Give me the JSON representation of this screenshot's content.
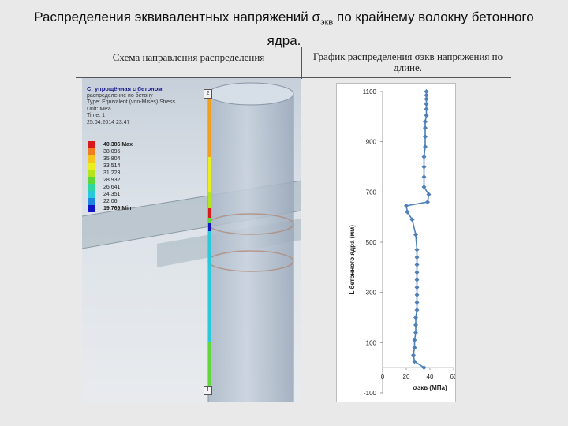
{
  "slide": {
    "title_part1": "Распределения эквивалентных напряжений σ",
    "title_sub": "экв",
    "title_part2": " по крайнему волокну бетонного ядра."
  },
  "table": {
    "left_header": "Схема направления распределения",
    "right_header": "График распределения σэкв напряжения по длине."
  },
  "simulation": {
    "title": "C: упрощённая с бетоном",
    "lines": [
      "распределение по бетону",
      "Type: Equivalent (von-Mises) Stress",
      "Unit: MPa",
      "Time: 1",
      "25.04.2014 23:47"
    ],
    "legend": [
      {
        "label": "40.386 Max",
        "color": "#d7191c",
        "bold": true
      },
      {
        "label": "38.095",
        "color": "#f07f21"
      },
      {
        "label": "35.804",
        "color": "#f7c520"
      },
      {
        "label": "33.514",
        "color": "#ecef1e"
      },
      {
        "label": "31.223",
        "color": "#b5e41d"
      },
      {
        "label": "28.932",
        "color": "#5fd63a"
      },
      {
        "label": "26.641",
        "color": "#2ed6a0"
      },
      {
        "label": "24.351",
        "color": "#29c9dc"
      },
      {
        "label": "22.06",
        "color": "#1f84df"
      },
      {
        "label": "19.769 Min",
        "color": "#1016c4",
        "bold": true
      }
    ],
    "node_top": "2",
    "node_bottom": "1"
  },
  "chart_data": {
    "type": "line",
    "xlabel": "σэкв (МПа)",
    "ylabel": "L бетонного ядра (мм)",
    "xlim": [
      0,
      60
    ],
    "ylim": [
      -100,
      1100
    ],
    "xticks": [
      0,
      20,
      40,
      60
    ],
    "yticks": [
      -100,
      100,
      300,
      500,
      700,
      900,
      1100
    ],
    "series": [
      {
        "color": "#4f7fb8",
        "x": [
          35,
          27,
          26,
          27,
          27,
          28,
          28,
          28,
          29,
          29,
          29,
          29,
          29,
          29,
          29,
          29,
          29,
          28,
          25,
          21,
          20,
          38,
          39,
          35,
          35,
          35,
          35,
          36,
          36,
          36,
          36,
          37,
          37,
          37,
          37,
          37,
          37
        ],
        "y": [
          0,
          25,
          50,
          80,
          110,
          140,
          170,
          200,
          230,
          260,
          290,
          320,
          350,
          380,
          410,
          440,
          470,
          530,
          590,
          620,
          645,
          660,
          690,
          720,
          760,
          800,
          840,
          880,
          920,
          955,
          980,
          1005,
          1030,
          1050,
          1070,
          1085,
          1100
        ]
      }
    ]
  }
}
